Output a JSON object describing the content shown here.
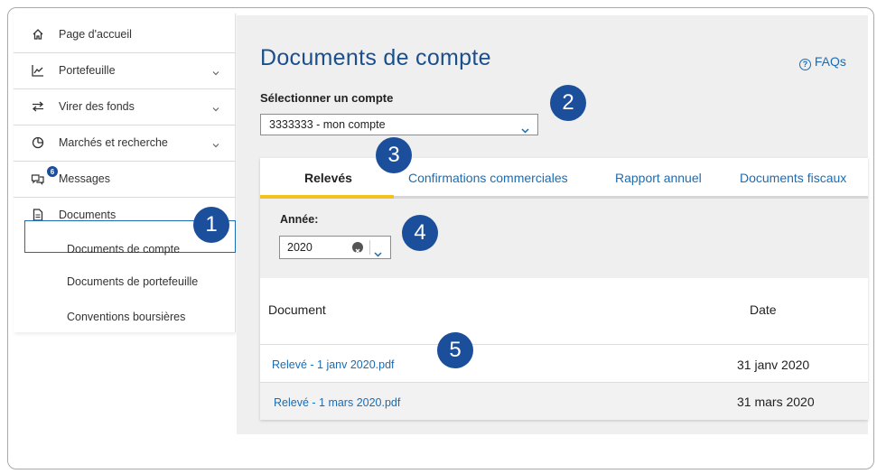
{
  "sidebar": {
    "items": [
      {
        "label": "Page d'accueil",
        "icon": "home-icon"
      },
      {
        "label": "Portefeuille",
        "icon": "chart-line-icon"
      },
      {
        "label": "Virer des fonds",
        "icon": "transfer-arrows-icon"
      },
      {
        "label": "Marchés et recherche",
        "icon": "pie-chart-icon"
      },
      {
        "label": "Messages",
        "icon": "chat-bubbles-icon",
        "badge": "6"
      },
      {
        "label": "Documents",
        "icon": "document-icon"
      }
    ],
    "sub_items": [
      {
        "label": "Documents de compte"
      },
      {
        "label": "Documents de portefeuille"
      },
      {
        "label": "Conventions boursières"
      }
    ]
  },
  "main": {
    "title": "Documents de compte",
    "faqs_label": "FAQs",
    "account_label": "Sélectionner un compte",
    "account_value": "3333333 - mon compte",
    "tabs": [
      {
        "label": "Relevés"
      },
      {
        "label": "Confirmations commerciales"
      },
      {
        "label": "Rapport annuel"
      },
      {
        "label": "Documents fiscaux"
      }
    ],
    "year_label": "Année:",
    "year_value": "2020",
    "table": {
      "headers": [
        "Document",
        "Date"
      ],
      "rows": [
        {
          "document": "Relevé - 1 janv 2020.pdf",
          "date": "31 janv 2020"
        },
        {
          "document": "Relevé - 1 mars 2020.pdf",
          "date": "31 mars 2020"
        }
      ]
    }
  },
  "markers": [
    "1",
    "2",
    "3",
    "4",
    "5"
  ],
  "colors": {
    "accent": "#1b6cb3",
    "marker": "#1b4f9c",
    "tab_underline": "#f3c21c"
  }
}
